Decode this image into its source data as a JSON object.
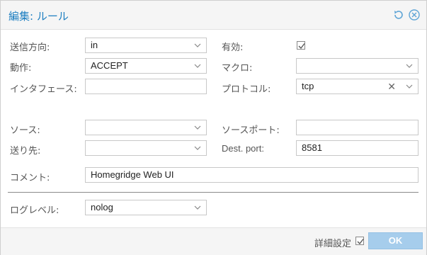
{
  "dialog": {
    "title": "編集: ルール",
    "reset_icon": "undo-icon",
    "close_icon": "close-circle-icon"
  },
  "form": {
    "direction": {
      "label": "送信方向:",
      "value": "in"
    },
    "action": {
      "label": "動作:",
      "value": "ACCEPT"
    },
    "interface": {
      "label": "インタフェース:",
      "value": ""
    },
    "enable": {
      "label": "有効:",
      "checked": true
    },
    "macro": {
      "label": "マクロ:",
      "value": ""
    },
    "protocol": {
      "label": "プロトコル:",
      "value": "tcp"
    },
    "source": {
      "label": "ソース:",
      "value": ""
    },
    "dest": {
      "label": "送り先:",
      "value": ""
    },
    "source_port": {
      "label": "ソースポート:",
      "value": ""
    },
    "dest_port": {
      "label": "Dest. port:",
      "value": "8581"
    },
    "comment": {
      "label": "コメント:",
      "value": "Homegridge Web UI"
    },
    "log_level": {
      "label": "ログレベル:",
      "value": "nolog"
    }
  },
  "footer": {
    "advanced_label": "詳細設定",
    "advanced_checked": true,
    "ok_label": "OK"
  },
  "colors": {
    "title": "#1e7fc1",
    "ok_button": "#a6cdec",
    "border": "#c8c8c8"
  }
}
